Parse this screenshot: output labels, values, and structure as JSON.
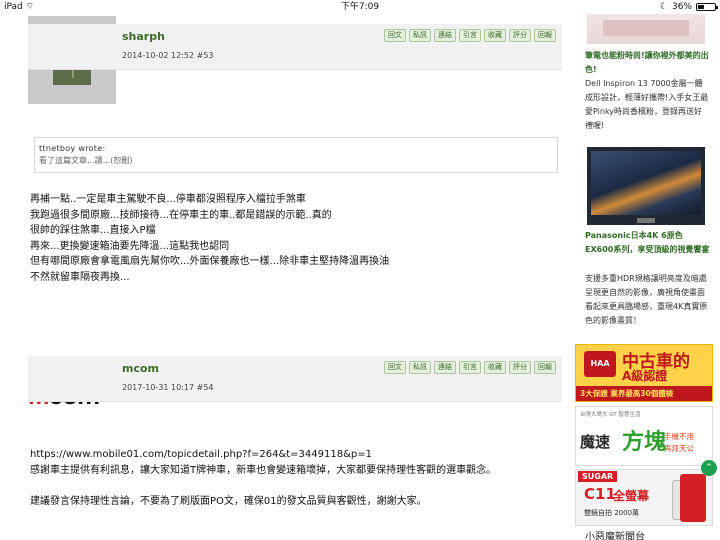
{
  "status": {
    "device": "iPad",
    "time": "下午7:09",
    "battery": "36%",
    "battery_level": 0.36
  },
  "actions": [
    "回文",
    "私訊",
    "連結",
    "引言",
    "收藏",
    "評分",
    "回報"
  ],
  "posts": [
    {
      "author": "sharph",
      "meta": "2014-10-02 12:52  #53",
      "quote": {
        "attribution": "ttnetboy wrote:",
        "text": "看了這篇文章...讀...(恕刪)"
      },
      "lines": [
        "再補一點..一定是車主駕駛不良...停車都沒照程序入檔拉手煞車",
        "我跑過很多間原廠...技師接待...在停車主的車..都是錯誤的示範..真的",
        "很帥的踩住煞車...直接入P檔",
        "再來...更換變速箱油要先降溫...這點我也認同",
        "但有哪間原廠會拿電風扇先幫你吹...外面保養廠也一樣...除非車主堅持降溫再換油",
        "不然就留車隔夜再換..."
      ]
    },
    {
      "author": "mcom",
      "meta": "2017-10-31 10:17  #54",
      "avatar_text": "Mcom",
      "url": "https://www.mobile01.com/topicdetail.php?f=264&t=3449118&p=1",
      "para1": "感謝車主提供有利訊息，讓大家知道T牌神車，新車也會變速箱壞掉，大家都要保持理性客觀的選車觀念。",
      "para2": "建議發言保持理性言論，不要為了刷版面PO文，確保01的發文品質與客觀性，謝謝大家。"
    }
  ],
  "sidebar": {
    "item1": {
      "title": "筆電也能粉時尚!讓你裡外都美的出色!",
      "desc": "Dell Inspiron 13 7000金屬一體成形設計，輕薄好攜帶!入手女王最愛Pinky時尚香檳粉，登錄再送好禮喔!"
    },
    "item2": {
      "title": "Panasonic日本4K 6原色EX600系列，享受頂級的視覺饗宴",
      "desc": "支援多重HDR規格讓明亮度及暗處呈現更自然的影像，廣視角使畫面看起來更具臨場感，重現4K真實原色的影像畫質！"
    },
    "ad1": {
      "badge": "HAA",
      "title": "中古車的",
      "title2": "A級認證",
      "strip": "3大保證  業界最高30個體檢"
    },
    "ad2": {
      "brand": "台灣大哥大 GT 智慧生活",
      "big1": "魔速",
      "big2": "方塊",
      "sub1": "手機不用",
      "sub2": "再拜天公"
    },
    "ad3": {
      "brand": "SUGAR",
      "model": "C11",
      "tagline": "全螢幕",
      "promo": "雙鏡自拍 2000萬"
    },
    "bottom_title": "小惡魔新聞台"
  }
}
